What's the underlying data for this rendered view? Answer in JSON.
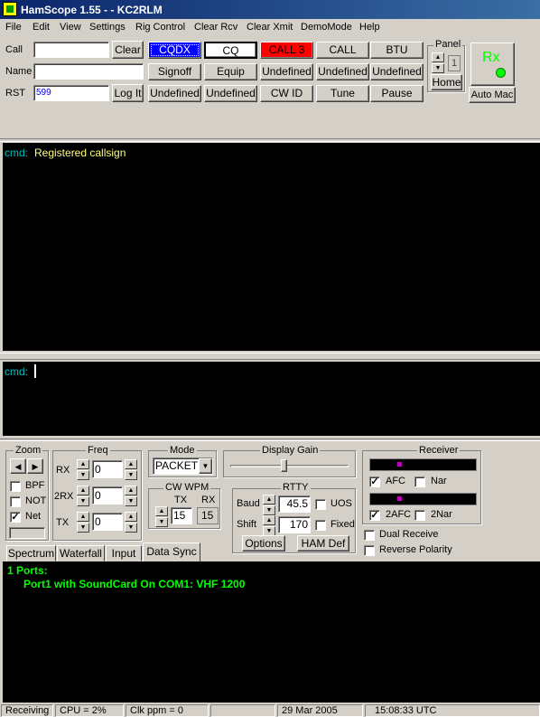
{
  "window": {
    "title": "HamScope 1.55 - - KC2RLM"
  },
  "menu": [
    "File",
    "Edit",
    "View",
    "Settings",
    "Rig Control",
    "Clear Rcv",
    "Clear Xmit",
    "DemoMode",
    "Help"
  ],
  "fields": {
    "call_label": "Call",
    "call_value": "",
    "name_label": "Name",
    "name_value": "",
    "rst_label": "RST",
    "rst_value": "599",
    "clear_button": "Clear",
    "logit_button": "Log It"
  },
  "macros": {
    "row1": [
      "CQDX",
      "CQ",
      "CALL 3",
      "CALL",
      "BTU"
    ],
    "row2": [
      "Signoff",
      "Equip",
      "Undefined",
      "Undefined",
      "Undefined"
    ],
    "row3": [
      "Undefined",
      "Undefined",
      "CW ID",
      "Tune",
      "Pause"
    ]
  },
  "panel": {
    "label": "Panel",
    "value": "1",
    "home_button": "Home"
  },
  "rx": {
    "label": "Rx",
    "automac_button": "Auto Mac"
  },
  "receive": {
    "prefix": "cmd:",
    "text": "Registered callsign"
  },
  "transmit": {
    "prefix": "cmd:"
  },
  "zoom": {
    "label": "Zoom",
    "bpf": "BPF",
    "not": "NOT",
    "net": "Net",
    "net_checked": true
  },
  "freq": {
    "label": "Freq",
    "rx_label": "RX",
    "rx_value": "0",
    "rx2_label": "2RX",
    "rx2_value": "0",
    "tx_label": "TX",
    "tx_value": "0"
  },
  "mode": {
    "label": "Mode",
    "value": "PACKET"
  },
  "cwwpm": {
    "label": "CW WPM",
    "tx_label": "TX",
    "rx_label": "RX",
    "tx_value": "15",
    "rx_value": "15"
  },
  "display_gain": {
    "label": "Display Gain",
    "level": 0.45
  },
  "rtty": {
    "label": "RTTY",
    "baud_label": "Baud",
    "baud_value": "45.5",
    "shift_label": "Shift",
    "shift_value": "170",
    "uos": "UOS",
    "fixed": "Fixed",
    "options_button": "Options",
    "hamdef_button": "HAM Def"
  },
  "receiver": {
    "label": "Receiver",
    "afc": "AFC",
    "afc_checked": true,
    "nar": "Nar",
    "afc2": "2AFC",
    "afc2_checked": true,
    "nar2": "2Nar",
    "dual_receive": "Dual Receive",
    "reverse_polarity": "Reverse Polarity"
  },
  "tabs": [
    "Spectrum",
    "Waterfall",
    "Input",
    "Data Sync"
  ],
  "datasync": {
    "line1": "1 Ports:",
    "line2": "Port1 with SoundCard On COM1: VHF 1200"
  },
  "status": {
    "state": "Receiving",
    "cpu": "CPU = 2%",
    "clk": "Clk ppm = 0",
    "date": "29 Mar 2005",
    "time": "15:08:33 UTC"
  },
  "colors": {
    "cqdx_bg": "#0000ff",
    "call3_bg": "#ff0000",
    "rx_green": "#00ff00",
    "term_cyan": "#00c0c0",
    "term_yellow": "#ffff80",
    "term_green": "#00ff00"
  }
}
